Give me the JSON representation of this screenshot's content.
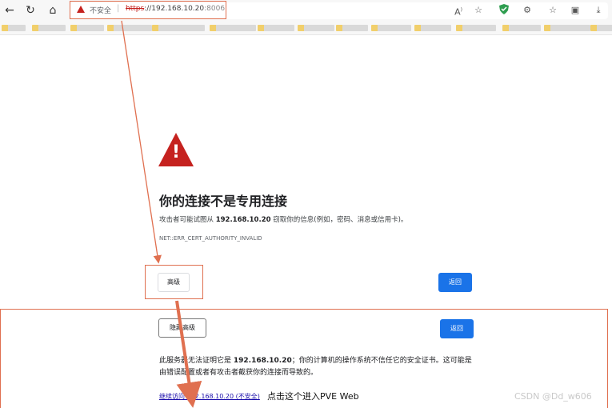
{
  "browser": {
    "nav": {
      "back_icon": "←",
      "reload_icon": "↻",
      "home_icon": "⌂"
    },
    "address": {
      "security_label": "不安全",
      "url_scheme": "https",
      "url_host": "://192.168.10.20",
      "url_port": ":8006"
    },
    "toolbar_icons": [
      "read-aloud-icon",
      "favorite-add-icon",
      "shield-extension-icon",
      "extensions-icon",
      "favorites-icon",
      "collections-icon",
      "downloads-icon"
    ]
  },
  "page": {
    "title": "你的连接不是专用连接",
    "desc_prefix": "攻击者可能试图从 ",
    "desc_host": "192.168.10.20",
    "desc_suffix": " 窃取你的信息(例如，密码、消息或信用卡)。",
    "error_code": "NET::ERR_CERT_AUTHORITY_INVALID",
    "advanced_button": "高级",
    "back_button": "返回",
    "hide_advanced_button": "隐藏高级",
    "back_button_2": "返回",
    "details_prefix": "此服务器无法证明它是 ",
    "details_host": "192.168.10.20",
    "details_suffix": "；你的计算机的操作系统不信任它的安全证书。这可能是由错误配置或者有攻击者截获你的连接而导致的。",
    "proceed_link": "继续访问 192.168.10.20 (不安全)"
  },
  "annotation": {
    "text": "点击这个进入PVE Web",
    "color": "#e07050"
  },
  "watermark": "CSDN @Dd_w606"
}
